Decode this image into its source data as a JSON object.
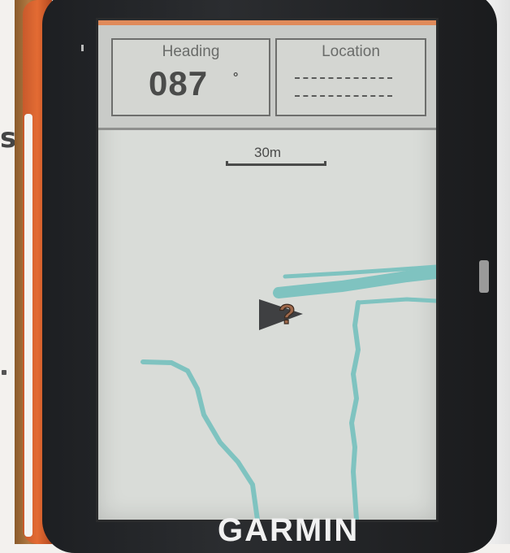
{
  "background": {
    "page_letter": "s"
  },
  "device": {
    "brand": "GARMIN"
  },
  "header": {
    "heading": {
      "label": "Heading",
      "value": "087",
      "unit": "°"
    },
    "location": {
      "label": "Location"
    }
  },
  "map": {
    "scale_label": "30m",
    "position_marker": "?"
  },
  "colors": {
    "screen": "#d9dcd8",
    "track": "#7fc3c0",
    "marker": "#3f4042",
    "question_mark": "#a06a4c",
    "device_accent": "#e36b33"
  }
}
